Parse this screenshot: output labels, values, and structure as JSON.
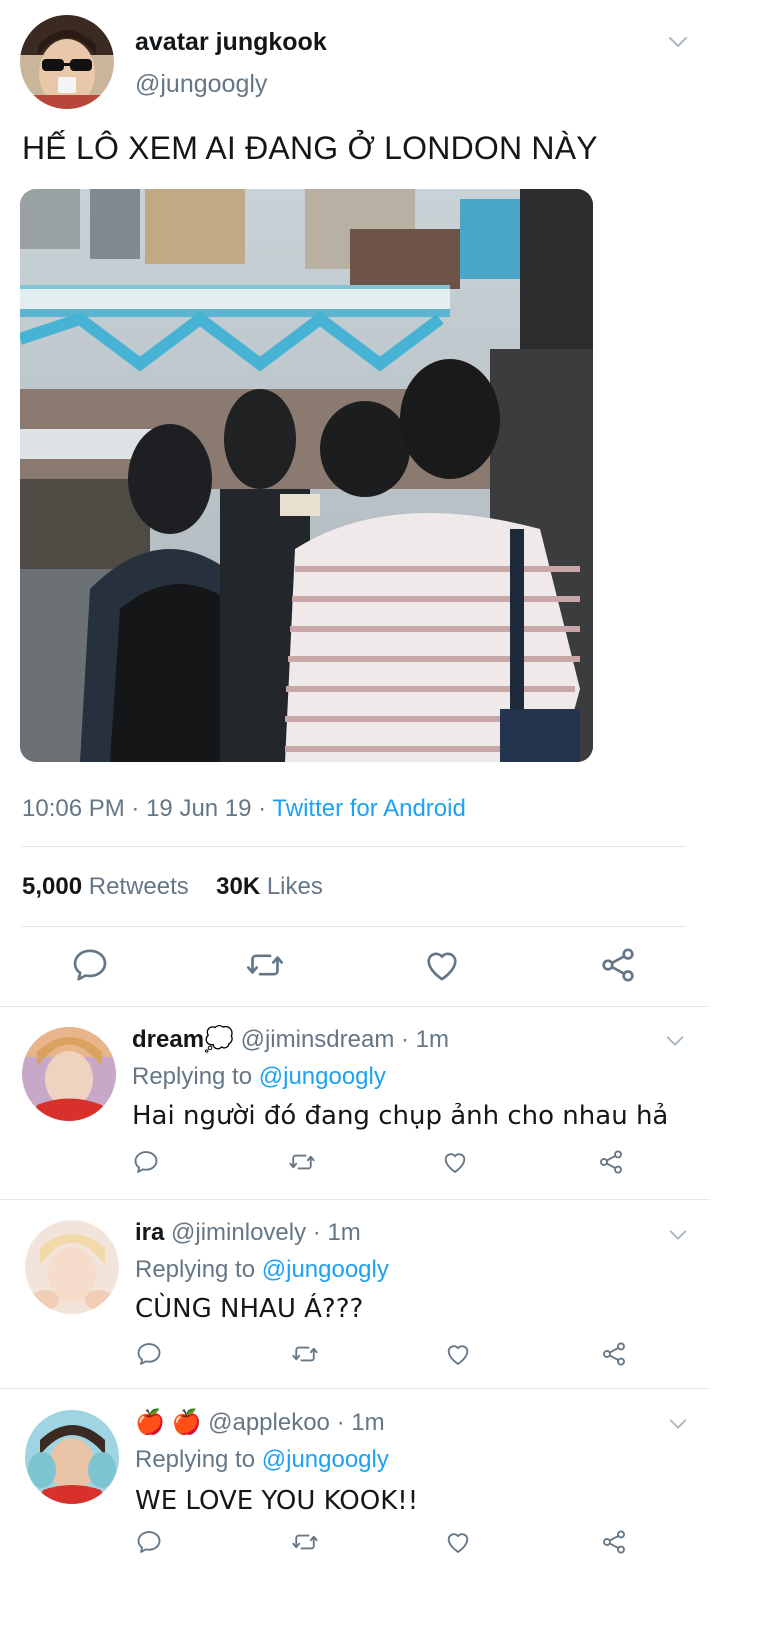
{
  "tweet": {
    "author_name": "avatar jungkook",
    "author_handle": "@jungoogly",
    "text": "HẾ LÔ XEM AI ĐANG Ở LONDON NÀY",
    "time": "10:06 PM",
    "date": "19 Jun 19",
    "source": "Twitter for Android",
    "separator": "·",
    "retweets_count": "5,000",
    "retweets_label": "Retweets",
    "likes_count": "30K",
    "likes_label": "Likes"
  },
  "replies": [
    {
      "name": "dream💭",
      "handle": "@jiminsdream",
      "time": "1m",
      "replying_label": "Replying to",
      "replying_to": "@jungoogly",
      "text": "Hai người đó đang chụp ảnh cho nhau hả"
    },
    {
      "name": "ira",
      "handle": "@jiminlovely",
      "time": "1m",
      "replying_label": "Replying to",
      "replying_to": "@jungoogly",
      "text": "CÙNG NHAU Á???"
    },
    {
      "name": "🍎 🍎",
      "handle": "@applekoo",
      "time": "1m",
      "replying_label": "Replying to",
      "replying_to": "@jungoogly",
      "text": "WE LOVE YOU KOOK!!"
    }
  ],
  "icons": {
    "reply": "reply-icon",
    "retweet": "retweet-icon",
    "like": "heart-icon",
    "share": "share-icon",
    "more": "chevron-down-icon"
  },
  "colors": {
    "link": "#1da1f2",
    "secondary_text": "#657786",
    "primary_text": "#14171a",
    "divider": "#e1e8ed"
  }
}
